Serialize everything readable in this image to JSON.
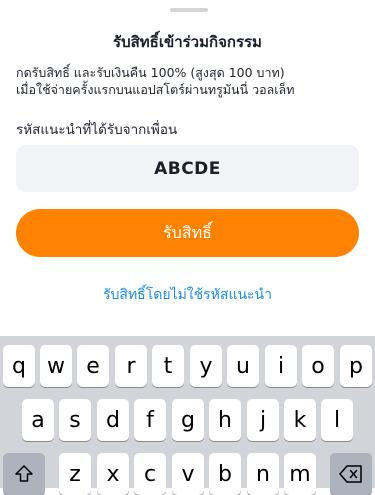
{
  "sheet": {
    "title": "รับสิทธิ์เข้าร่วมกิจกรรม",
    "description_line1": "กดรับสิทธิ์ และรับเงินคืน 100% (สูงสุด 100 บาท)",
    "description_line2": "เมื่อใช้จ่ายครั้งแรกบนแอปสโตร์ผ่านทรูมันนี่ วอลเล็ท",
    "referral_label": "รหัสแนะนำที่ได้รับจากเพื่อน",
    "referral_code": "ABCDE",
    "claim_button": "รับสิทธิ์",
    "no_code_link": "รับสิทธิ์โดยไม่ใช้รหัสแนะนำ"
  },
  "keyboard": {
    "row1": [
      "q",
      "w",
      "e",
      "r",
      "t",
      "y",
      "u",
      "i",
      "o",
      "p"
    ],
    "row2": [
      "a",
      "s",
      "d",
      "f",
      "g",
      "h",
      "j",
      "k",
      "l"
    ],
    "row3": [
      "z",
      "x",
      "c",
      "v",
      "b",
      "n",
      "m"
    ],
    "shift_icon": "shift-icon",
    "delete_icon": "delete-icon"
  },
  "colors": {
    "accent": "#ff8200",
    "link": "#1b8fd6",
    "input_bg": "#f2f3f7",
    "keyboard_bg": "#d1d4d9"
  }
}
